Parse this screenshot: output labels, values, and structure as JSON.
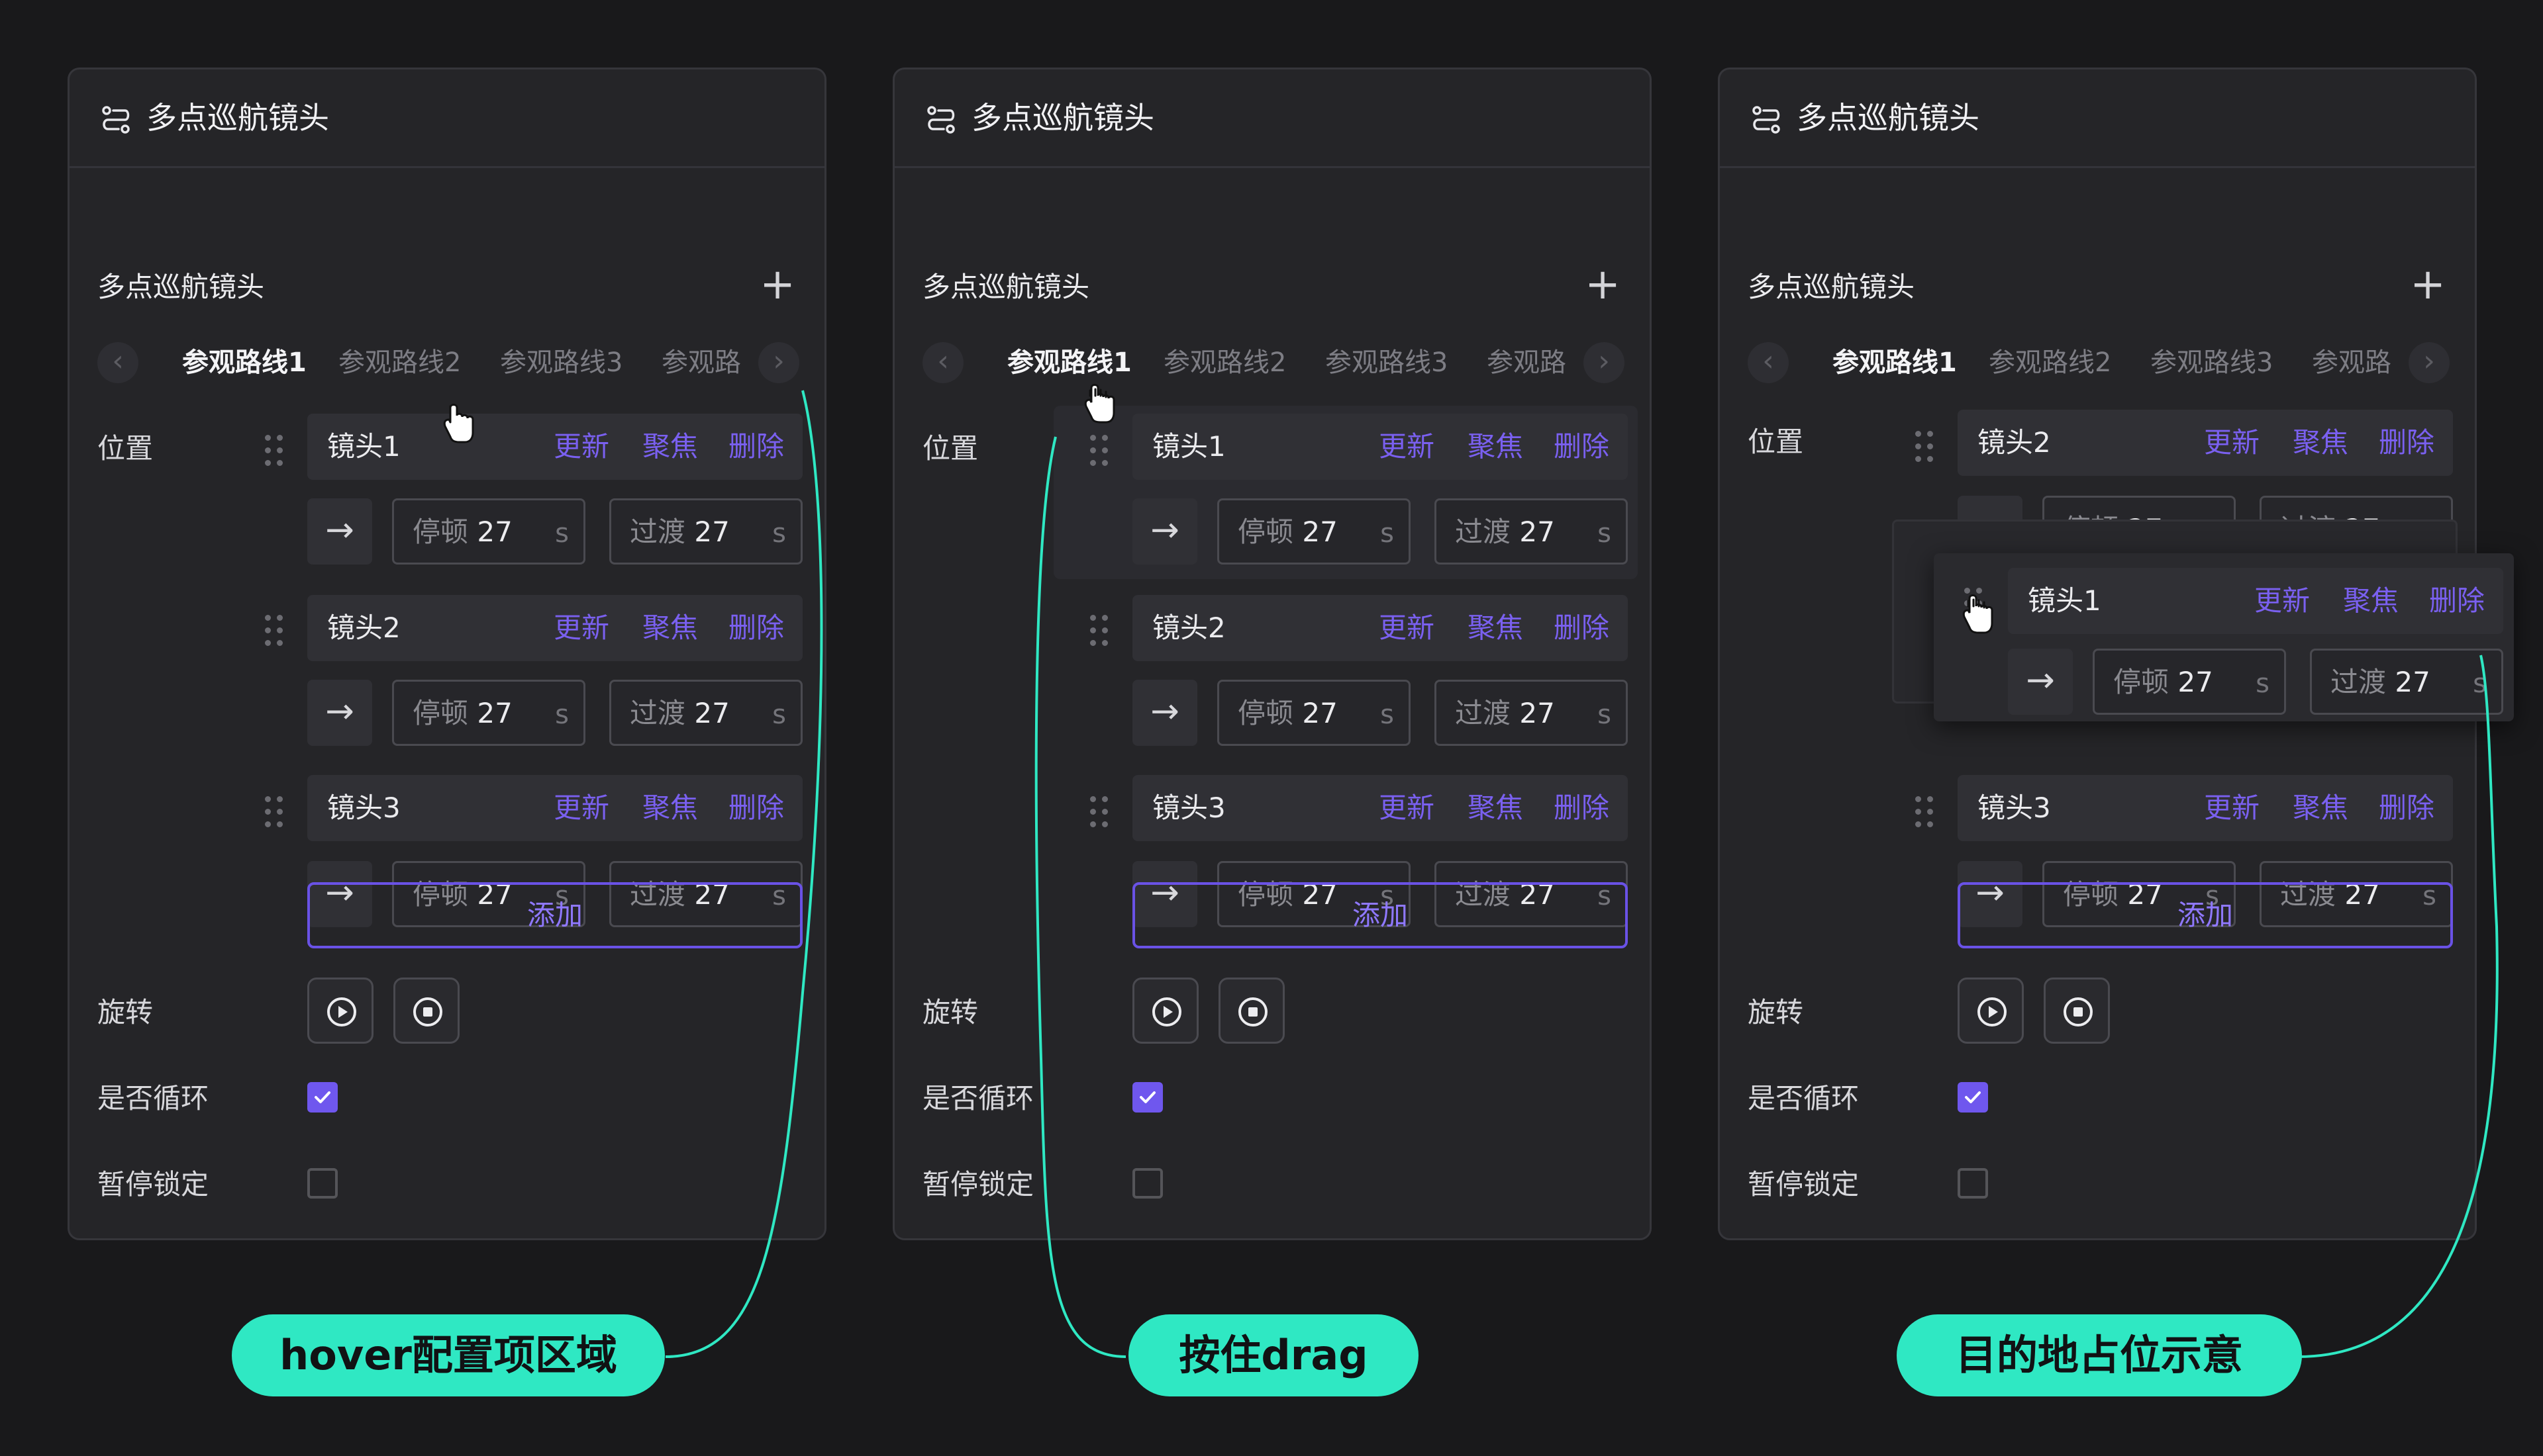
{
  "panel_title": "多点巡航镜头",
  "section_title": "多点巡航镜头",
  "tabs": [
    "参观路线1",
    "参观路线2",
    "参观路线3",
    "参观路"
  ],
  "labels": {
    "position": "位置",
    "rotation": "旋转",
    "loop": "是否循环",
    "pause_lock": "暂停锁定"
  },
  "actions": {
    "update": "更新",
    "focus": "聚焦",
    "delete": "删除"
  },
  "field_labels": {
    "dwell": "停顿",
    "transition": "过渡",
    "unit": "s"
  },
  "field_values": {
    "dwell": "27",
    "transition": "27"
  },
  "cameras": {
    "cam1": "镜头1",
    "cam2": "镜头2",
    "cam3": "镜头3"
  },
  "add_button": "添加",
  "loop_checked": true,
  "pause_lock_checked": false,
  "annotations": [
    "hover配置项区域",
    "按住drag",
    "目的地占位示意"
  ],
  "colors": {
    "accent": "#6f57ee",
    "annotation": "#2fe8c3",
    "panel": "#252528",
    "background": "#19191b"
  },
  "icons": {
    "route": "route-icon",
    "add": "plus-icon",
    "prev": "chevron-left-icon",
    "next": "chevron-right-icon",
    "drag": "drag-handle-icon",
    "play": "play-icon",
    "stop": "stop-icon",
    "check": "check-icon",
    "cursor": "hand-cursor-icon"
  }
}
